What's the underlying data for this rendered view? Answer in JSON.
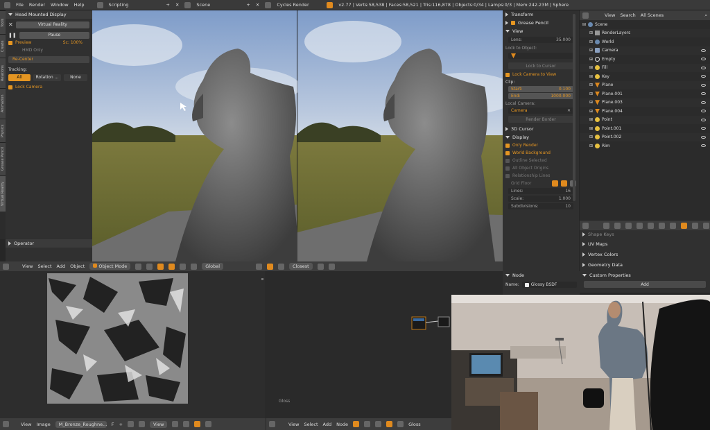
{
  "topbar": {
    "menus": [
      "File",
      "Render",
      "Window",
      "Help"
    ],
    "screen": "Scripting",
    "scene": "Scene",
    "engine": "Cycles Render",
    "stats": "v2.77 | Verts:58,538 | Faces:58,521 | Tris:116,878 | Objects:0/34 | Lamps:0/3 | Mem:242.23M | Sphere"
  },
  "toolshelf": {
    "tabs": [
      "Tools",
      "Create",
      "Relations",
      "Animation",
      "Physics",
      "Grease Pencil",
      "Virtual Reality"
    ],
    "panel_title": "Head Mounted Display",
    "vr_label": "Virtual Reality",
    "pause_label": "Pause",
    "preview_label": "Preview",
    "preview_scale": "Sc: 100%",
    "hmd_label": "HMD Only",
    "recenter_label": "Re-Center",
    "tracking_label": "Tracking:",
    "tracking_options": [
      "All",
      "Rotation ...",
      "None"
    ],
    "lock_camera_label": "Lock Camera",
    "operator_label": "Operator"
  },
  "viewport_header": {
    "items": [
      "View",
      "Select",
      "Add",
      "Object"
    ],
    "mode": "Object Mode",
    "pivot": "Global",
    "shading": "Closest"
  },
  "properties": {
    "sections": {
      "transform": "Transform",
      "grease": "Grease Pencil",
      "view": "View",
      "cursor": "3D Cursor",
      "display": "Display"
    },
    "lens_label": "Lens:",
    "lens_value": "35.000",
    "lock_object_label": "Lock to Object:",
    "lock_cursor_label": "Lock to Cursor",
    "lock_camera_view": "Lock Camera to View",
    "clip_label": "Clip:",
    "clip_start_label": "Start:",
    "clip_start": "0.100",
    "clip_end_label": "End:",
    "clip_end": "1000.000",
    "local_camera_label": "Local Camera:",
    "local_camera": "Camera",
    "render_border": "Render Border",
    "only_render": "Only Render",
    "world_background": "World Background",
    "outline_selected": "Outline Selected",
    "all_object_origins": "All Object Origins",
    "relationship_lines": "Relationship Lines",
    "grid_floor": "Grid Floor",
    "lines_label": "Lines:",
    "lines_value": "16",
    "scale_label": "Scale:",
    "scale_value": "1.000",
    "subdiv_label": "Subdivisions:",
    "subdiv_value": "10"
  },
  "outliner": {
    "header": [
      "View",
      "Search",
      "All Scenes"
    ],
    "items": [
      {
        "label": "Scene",
        "icon": "world"
      },
      {
        "label": "RenderLayers",
        "icon": "layer"
      },
      {
        "label": "World",
        "icon": "world"
      },
      {
        "label": "Camera",
        "icon": "cam"
      },
      {
        "label": "Empty",
        "icon": "empty"
      },
      {
        "label": "Fill",
        "icon": "lamp"
      },
      {
        "label": "Key",
        "icon": "lamp"
      },
      {
        "label": "Plane",
        "icon": "obj"
      },
      {
        "label": "Plane.001",
        "icon": "obj"
      },
      {
        "label": "Plane.003",
        "icon": "obj"
      },
      {
        "label": "Plane.004",
        "icon": "obj"
      },
      {
        "label": "Point",
        "icon": "lamp"
      },
      {
        "label": "Point.001",
        "icon": "lamp"
      },
      {
        "label": "Point.002",
        "icon": "lamp"
      },
      {
        "label": "Rim",
        "icon": "lamp"
      }
    ]
  },
  "mesh_data": {
    "items": [
      "Shape Keys",
      "UV Maps",
      "Vertex Colors",
      "Geometry Data",
      "Custom Properties"
    ],
    "add_label": "Add"
  },
  "image_editor": {
    "header": [
      "View",
      "Image"
    ],
    "image_name": "M_Bronze_Roughne...",
    "view_label": "View"
  },
  "node_editor": {
    "header": [
      "View",
      "Select",
      "Add",
      "Node"
    ],
    "shading": "Gloss",
    "label": "Gloss",
    "node_panel_title": "Node",
    "name_label": "Name:",
    "name_value": "Glossy BSDF"
  }
}
